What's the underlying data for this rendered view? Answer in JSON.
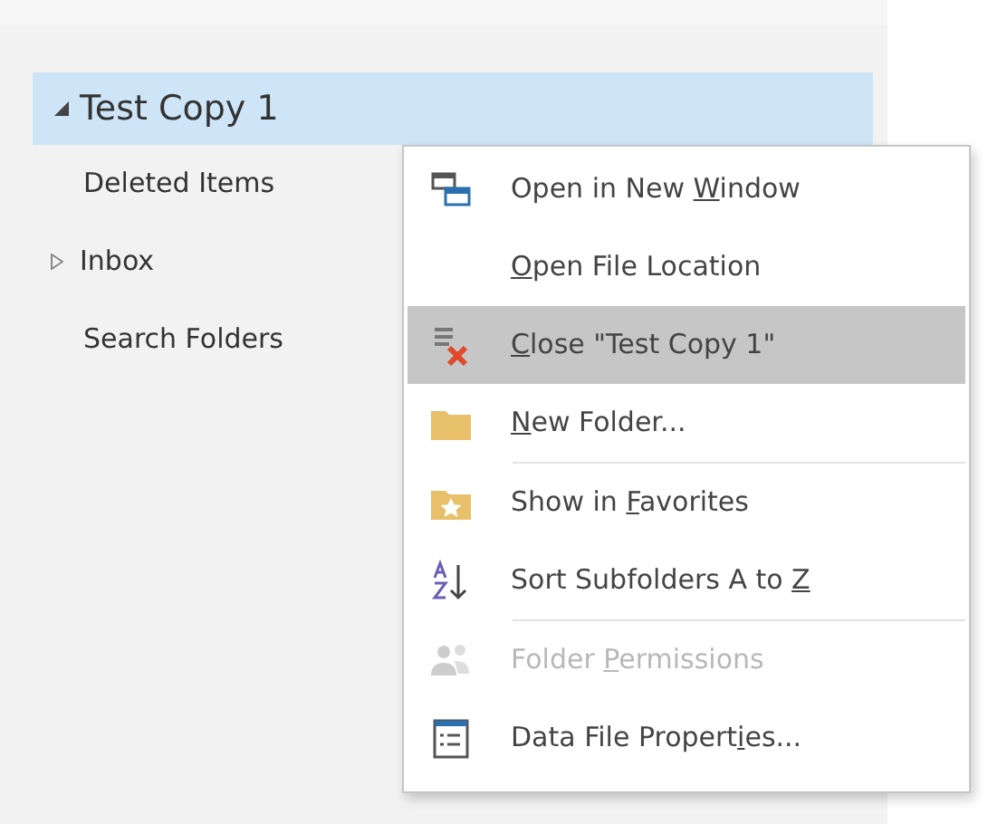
{
  "folder_tree": {
    "root": {
      "label": "Test Copy 1",
      "expanded": true,
      "selected": true,
      "children": [
        {
          "label": "Deleted Items",
          "has_children": false
        },
        {
          "label": "Inbox",
          "has_children": true
        },
        {
          "label": "Search Folders",
          "has_children": false
        }
      ]
    }
  },
  "context_menu": {
    "items": [
      {
        "before": "Open in New ",
        "key": "W",
        "after": "indow",
        "highlighted": false,
        "disabled": false,
        "separator_after": false
      },
      {
        "key": "O",
        "after": "pen File Location",
        "highlighted": false,
        "disabled": false,
        "separator_after": false
      },
      {
        "key": "C",
        "after": "lose \"Test Copy 1\"",
        "highlighted": true,
        "disabled": false,
        "separator_after": false
      },
      {
        "key": "N",
        "after": "ew Folder...",
        "highlighted": false,
        "disabled": false,
        "separator_after": true
      },
      {
        "before": "Show in ",
        "key": "F",
        "after": "avorites",
        "highlighted": false,
        "disabled": false,
        "separator_after": false
      },
      {
        "before": "Sort Subfolders A to ",
        "key": "Z",
        "highlighted": false,
        "disabled": false,
        "separator_after": true
      },
      {
        "before": "Folder ",
        "key": "P",
        "after": "ermissions",
        "highlighted": false,
        "disabled": true,
        "separator_after": false
      },
      {
        "before": "Data File Propert",
        "key": "i",
        "after": "es...",
        "highlighted": false,
        "disabled": false,
        "separator_after": false
      }
    ]
  }
}
